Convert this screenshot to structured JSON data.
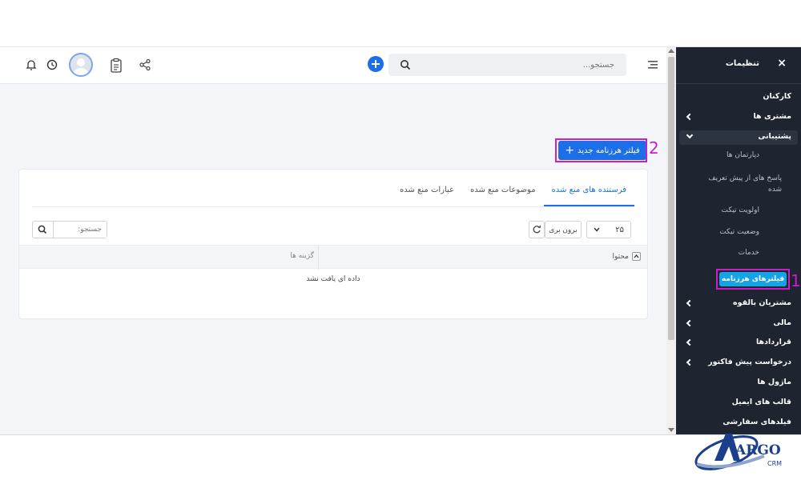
{
  "header": {
    "search_placeholder": "جستجو..."
  },
  "main": {
    "new_filter_label": "فیلتر هرزنامه جدید",
    "plus_glyph": "+",
    "callout_2": "2",
    "tabs": [
      {
        "label": "فرستنده های منع شده",
        "active": true
      },
      {
        "label": "موضوعات منع شده",
        "active": false
      },
      {
        "label": "عبارات منع شده",
        "active": false
      }
    ],
    "page_size": "۲۵",
    "export_label": "برون بری",
    "table_search_placeholder": "جستجو:",
    "columns": [
      "محتوا",
      "گزینه ها"
    ],
    "empty_message": "داده ای یافت نشد"
  },
  "sidebar": {
    "title": "تنظیمات",
    "close_glyph": "×",
    "items": [
      {
        "label": "کارکنان"
      },
      {
        "label": "مشتری ها"
      },
      {
        "label": "پشتیبانی"
      },
      {
        "label": "دپارتمان ها"
      },
      {
        "label": "پاسخ های از پیش تعریف شده"
      },
      {
        "label": "اولویت تیکت"
      },
      {
        "label": "وضعیت تیکت"
      },
      {
        "label": "خدمات"
      },
      {
        "label": "فیلترهای هرزنامه"
      },
      {
        "label": "مشتریان بالقوه"
      },
      {
        "label": "مالی"
      },
      {
        "label": "قراردادها"
      },
      {
        "label": "درخواست پیش فاکتور"
      },
      {
        "label": "ماژول ها"
      },
      {
        "label": "قالب های ایمیل"
      },
      {
        "label": "فیلدهای سفارشی"
      }
    ],
    "callout_1": "1"
  },
  "logo": {
    "text": "ARGO",
    "sub": "CRM"
  },
  "colors": {
    "accent": "#1d6fe8",
    "sidebar_bg": "#1e2430",
    "highlight": "#c81ec8",
    "active_pill": "#14a3e6"
  }
}
